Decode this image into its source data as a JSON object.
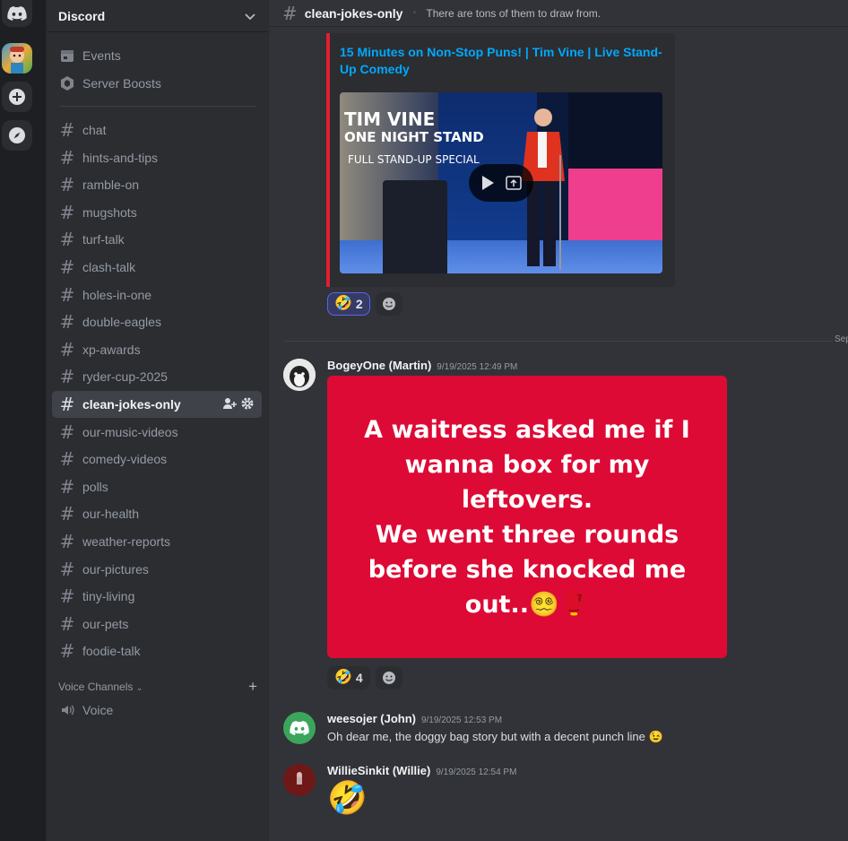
{
  "server": {
    "name": "Discord",
    "nav_items": [
      {
        "label": "Events",
        "icon": "calendar-icon"
      },
      {
        "label": "Server Boosts",
        "icon": "boost-icon"
      }
    ],
    "channels": [
      "chat",
      "hints-and-tips",
      "ramble-on",
      "mugshots",
      "turf-talk",
      "clash-talk",
      "holes-in-one",
      "double-eagles",
      "xp-awards",
      "ryder-cup-2025",
      "clean-jokes-only",
      "our-music-videos",
      "comedy-videos",
      "polls",
      "our-health",
      "weather-reports",
      "our-pictures",
      "tiny-living",
      "our-pets",
      "foodie-talk"
    ],
    "active_channel_index": 10,
    "voice_section_label": "Voice Channels",
    "voice_channels": [
      "Voice"
    ]
  },
  "channel": {
    "name": "clean-jokes-only",
    "topic": "There are tons of them to draw from."
  },
  "embed": {
    "title": "15 Minutes on Non-Stop Puns! | Tim Vine | Live Stand-Up Comedy",
    "video_title_line1": "TIM VINE",
    "video_title_line2": "ONE NIGHT STAND",
    "video_title_line3": "FULL STAND-UP SPECIAL",
    "accent_color": "#e01f2f"
  },
  "date_divider": "Sep",
  "messages": [
    {
      "author": "BogeyOne (Martin)",
      "timestamp": "9/19/2025 12:49 PM",
      "image_text": "A waitress asked me if I\nwanna box for my\nleftovers.\nWe went three rounds\nbefore she knocked me\nout..😵‍💫🥊",
      "image_bg": "#dd0a35"
    },
    {
      "author": "weesojer (John)",
      "timestamp": "9/19/2025 12:53 PM",
      "text": "Oh dear me, the doggy bag story but with a decent punch line 😉"
    },
    {
      "author": "WillieSinkit (Willie)",
      "timestamp": "9/19/2025 12:54 PM",
      "text": "🤣"
    }
  ],
  "reactions": {
    "embed": {
      "emoji": "🤣",
      "count": "2"
    },
    "joke": {
      "emoji": "🤣",
      "count": "4"
    }
  }
}
